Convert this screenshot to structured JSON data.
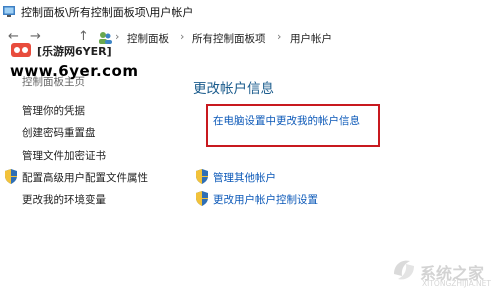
{
  "window": {
    "title": "控制面板\\所有控制面板项\\用户帐户"
  },
  "nav": {
    "back": "←",
    "forward": "→",
    "up": "↑"
  },
  "breadcrumb": {
    "items": [
      "控制面板",
      "所有控制面板项",
      "用户帐户"
    ],
    "separator": "›"
  },
  "watermark": {
    "site": "[乐游网6YER]",
    "url": "www.6yer.com"
  },
  "sidebar": {
    "partial_item": "控制面板主页",
    "items": [
      "管理你的凭据",
      "创建密码重置盘",
      "管理文件加密证书",
      "配置高级用户配置文件属性",
      "更改我的环境变量"
    ]
  },
  "main": {
    "heading": "更改帐户信息",
    "highlighted_link": "在电脑设置中更改我的帐户信息",
    "tasks": [
      "管理其他帐户",
      "更改用户帐户控制设置"
    ]
  },
  "brand": {
    "name": "系统之家",
    "url": "XITONGZHIJIA.NET"
  },
  "colors": {
    "link": "#0b58b8",
    "heading": "#1a5b8c",
    "highlight_border": "#c8191f"
  }
}
